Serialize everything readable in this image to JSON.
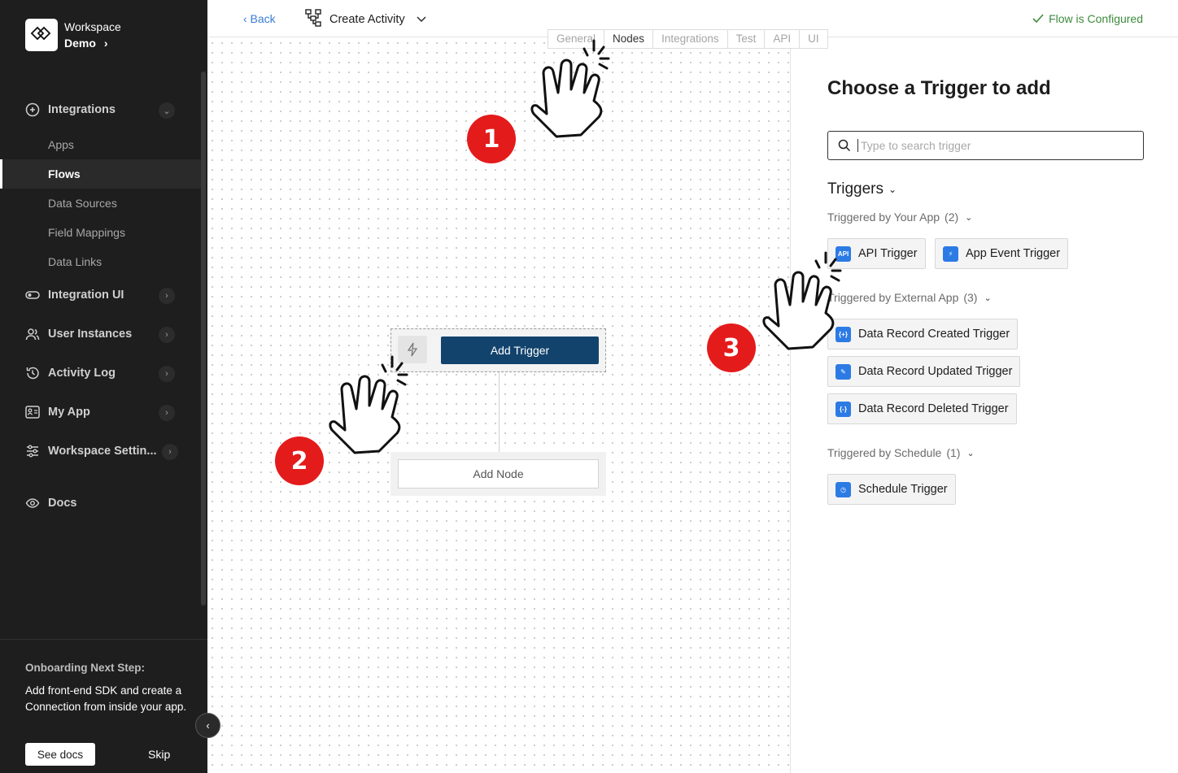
{
  "workspace": {
    "name": "Workspace",
    "demo": "Demo"
  },
  "sidebar": {
    "items": [
      {
        "label": "Integrations",
        "icon": "integrations-icon"
      },
      {
        "label": "Integration UI",
        "icon": "toggle-icon"
      },
      {
        "label": "User Instances",
        "icon": "users-icon"
      },
      {
        "label": "Activity Log",
        "icon": "history-icon"
      },
      {
        "label": "My App",
        "icon": "app-icon"
      },
      {
        "label": "Workspace Settin...",
        "icon": "settings-sliders-icon"
      },
      {
        "label": "Docs",
        "icon": "eye-icon"
      }
    ],
    "sub_items": [
      "Apps",
      "Flows",
      "Data Sources",
      "Field Mappings",
      "Data Links"
    ],
    "active_sub": "Flows"
  },
  "onboarding": {
    "title": "Onboarding Next Step:",
    "text": "Add front-end SDK and create a Connection from inside your app.",
    "docs_label": "See docs",
    "skip_label": "Skip"
  },
  "topbar": {
    "back_label": "‹ Back",
    "flow_title": "Create Activity",
    "status": "Flow is Configured",
    "status_color": "#3d8a3d",
    "tabs": [
      "General",
      "Nodes",
      "Integrations",
      "Test",
      "API",
      "UI"
    ],
    "active_tab": "Nodes"
  },
  "canvas": {
    "add_trigger_label": "Add Trigger",
    "add_node_label": "Add Node"
  },
  "panel": {
    "title": "Choose a Trigger to add",
    "search_placeholder": "Type to search trigger",
    "triggers_heading": "Triggers",
    "groups": [
      {
        "label": "Triggered by Your App",
        "count": "(2)",
        "items": [
          "API Trigger",
          "App Event Trigger"
        ]
      },
      {
        "label": "Triggered by External App",
        "count": "(3)",
        "items": [
          "Data Record Created Trigger",
          "Data Record Updated Trigger",
          "Data Record Deleted Trigger"
        ]
      },
      {
        "label": "Triggered by Schedule",
        "count": "(1)",
        "items": [
          "Schedule Trigger"
        ]
      }
    ]
  },
  "annotations": {
    "steps": [
      "1",
      "2",
      "3"
    ],
    "badge_color": "#e41b1b"
  },
  "colors": {
    "sidebar_bg": "#1e1e1e",
    "primary_button": "#12436d",
    "trigger_icon": "#2c7be5"
  }
}
